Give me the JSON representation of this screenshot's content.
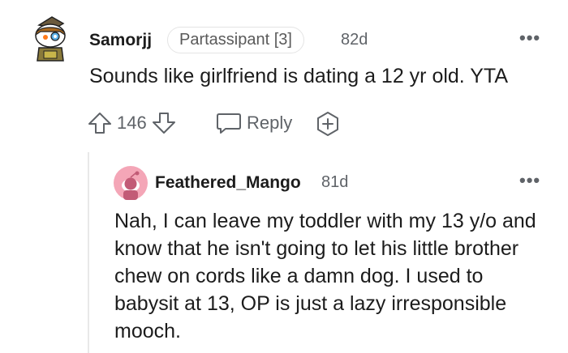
{
  "comments": [
    {
      "username": "Samorjj",
      "flair": "Partassipant [3]",
      "age": "82d",
      "body": "Sounds like girlfriend is dating a 12 yr old. YTA",
      "votes": "146",
      "reply_label": "Reply",
      "more_icon": "more-options-icon"
    },
    {
      "username": "Feathered_Mango",
      "age": "81d",
      "body": "Nah, I can leave my toddler with my 13 y/o and know that he isn't going to let his little brother chew on cords like a damn dog. I used to babysit at 13, OP is just a lazy irresponsible mooch.",
      "more_icon": "more-options-icon"
    }
  ],
  "colors": {
    "text": "#1c1c1c",
    "muted": "#5f6368",
    "reply_avatar_bg": "#f4a6b7"
  }
}
